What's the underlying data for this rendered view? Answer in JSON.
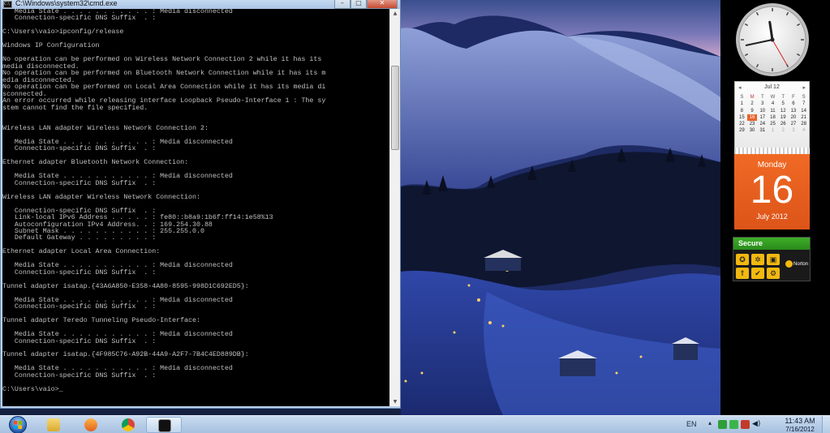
{
  "window": {
    "title": "C:\\Windows\\system32\\cmd.exe",
    "icon": "console-icon",
    "controls": {
      "minimize": "–",
      "maximize": "□",
      "close": "✕"
    }
  },
  "console": {
    "lines": [
      "   Media State . . . . . . . . . . . : Media disconnected",
      "   Connection-specific DNS Suffix  . :",
      "",
      "C:\\Users\\vaio>ipconfig/release",
      "",
      "Windows IP Configuration",
      "",
      "No operation can be performed on Wireless Network Connection 2 while it has its",
      "media disconnected.",
      "No operation can be performed on Bluetooth Network Connection while it has its m",
      "edia disconnected.",
      "No operation can be performed on Local Area Connection while it has its media di",
      "sconnected.",
      "An error occurred while releasing interface Loopback Pseudo-Interface 1 : The sy",
      "stem cannot find the file specified.",
      "",
      "",
      "Wireless LAN adapter Wireless Network Connection 2:",
      "",
      "   Media State . . . . . . . . . . . : Media disconnected",
      "   Connection-specific DNS Suffix  . :",
      "",
      "Ethernet adapter Bluetooth Network Connection:",
      "",
      "   Media State . . . . . . . . . . . : Media disconnected",
      "   Connection-specific DNS Suffix  . :",
      "",
      "Wireless LAN adapter Wireless Network Connection:",
      "",
      "   Connection-specific DNS Suffix  . :",
      "   Link-local IPv6 Address . . . . . : fe80::b8a9:1b6f:ff14:1e58%13",
      "   Autoconfiguration IPv4 Address. . : 169.254.30.88",
      "   Subnet Mask . . . . . . . . . . . : 255.255.0.0",
      "   Default Gateway . . . . . . . . . :",
      "",
      "Ethernet adapter Local Area Connection:",
      "",
      "   Media State . . . . . . . . . . . : Media disconnected",
      "   Connection-specific DNS Suffix  . :",
      "",
      "Tunnel adapter isatap.{43A6A850-E358-4A80-8595-998D1C692ED5}:",
      "",
      "   Media State . . . . . . . . . . . : Media disconnected",
      "   Connection-specific DNS Suffix  . :",
      "",
      "Tunnel adapter Teredo Tunneling Pseudo-Interface:",
      "",
      "   Media State . . . . . . . . . . . : Media disconnected",
      "   Connection-specific DNS Suffix  . :",
      "",
      "Tunnel adapter isatap.{4F985C76-A92B-44A9-A2F7-7B4C4ED889DB}:",
      "",
      "   Media State . . . . . . . . . . . : Media disconnected",
      "   Connection-specific DNS Suffix  . :",
      "",
      "C:\\Users\\vaio>_"
    ]
  },
  "calendar": {
    "month_label": "Jul 12",
    "prev": "◂",
    "next": "▸",
    "weekdays": [
      "S",
      "M",
      "T",
      "W",
      "T",
      "F",
      "S"
    ],
    "days": [
      "1",
      "2",
      "3",
      "4",
      "5",
      "6",
      "7",
      "8",
      "9",
      "10",
      "11",
      "12",
      "13",
      "14",
      "15",
      "16",
      "17",
      "18",
      "19",
      "20",
      "21",
      "22",
      "23",
      "24",
      "25",
      "26",
      "27",
      "28",
      "29",
      "30",
      "31",
      "1",
      "2",
      "3",
      "4"
    ],
    "today_index": 15,
    "weekday_name": "Monday",
    "day_number": "16",
    "month_year": "July 2012"
  },
  "clock_gadget": {
    "hour": 11,
    "minute": 43
  },
  "norton": {
    "status": "Secure",
    "brand": "Norton",
    "icons": [
      "shield-icon",
      "settings-icon",
      "lock-icon",
      "update-icon",
      "check-icon",
      "scan-icon"
    ]
  },
  "taskbar": {
    "pinned": [
      "explorer-icon",
      "media-player-icon",
      "chrome-icon",
      "console-icon"
    ],
    "active": "console-icon",
    "language": "EN",
    "tray_arrow": "▴",
    "time": "11:43 AM",
    "date": "7/16/2012"
  },
  "colors": {
    "console_bg": "#000000",
    "console_fg": "#c0c0c0",
    "calendar_accent": "#e8622c",
    "norton_green": "#3fae2a",
    "taskbar": "#b8cfe8"
  }
}
